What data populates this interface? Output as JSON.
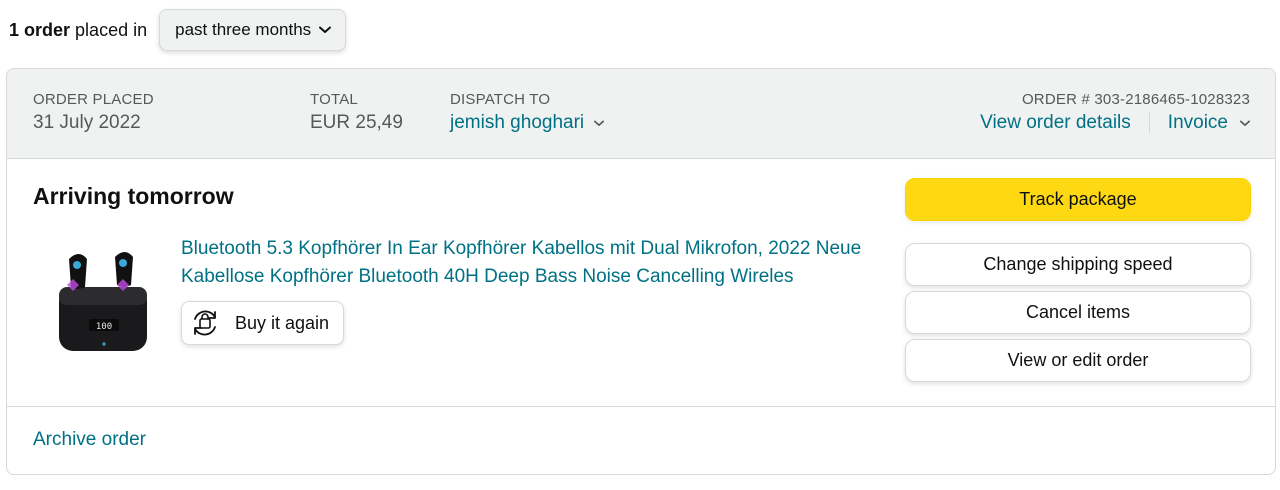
{
  "summary": {
    "count": "1 order",
    "placed_in": "placed in",
    "period": "past three months"
  },
  "order": {
    "placed_label": "ORDER PLACED",
    "placed_value": "31 July 2022",
    "total_label": "TOTAL",
    "total_value": "EUR 25,49",
    "dispatch_label": "DISPATCH TO",
    "dispatch_value": "jemish ghoghari",
    "order_number": "ORDER # 303-2186465-1028323",
    "view_details": "View order details",
    "invoice": "Invoice",
    "status": "Arriving tomorrow",
    "product_title": "Bluetooth 5.3 Kopfhörer In Ear Kopfhörer Kabellos mit Dual Mikrofon, 2022 Neue Kabellose Kopfhörer Bluetooth 40H Deep Bass Noise Cancelling Wireles",
    "product_display": "100",
    "buy_again": "Buy it again",
    "actions": {
      "track": "Track package",
      "change_shipping": "Change shipping speed",
      "cancel": "Cancel items",
      "view_edit": "View or edit order"
    },
    "archive": "Archive order"
  },
  "colors": {
    "link": "#007185",
    "primary_button": "#ffd814",
    "header_bg": "#f0f2f2",
    "border": "#d5d9d9"
  },
  "icons": {
    "dropdown": "chevron-down-icon",
    "buy_again": "buy-again-icon"
  }
}
